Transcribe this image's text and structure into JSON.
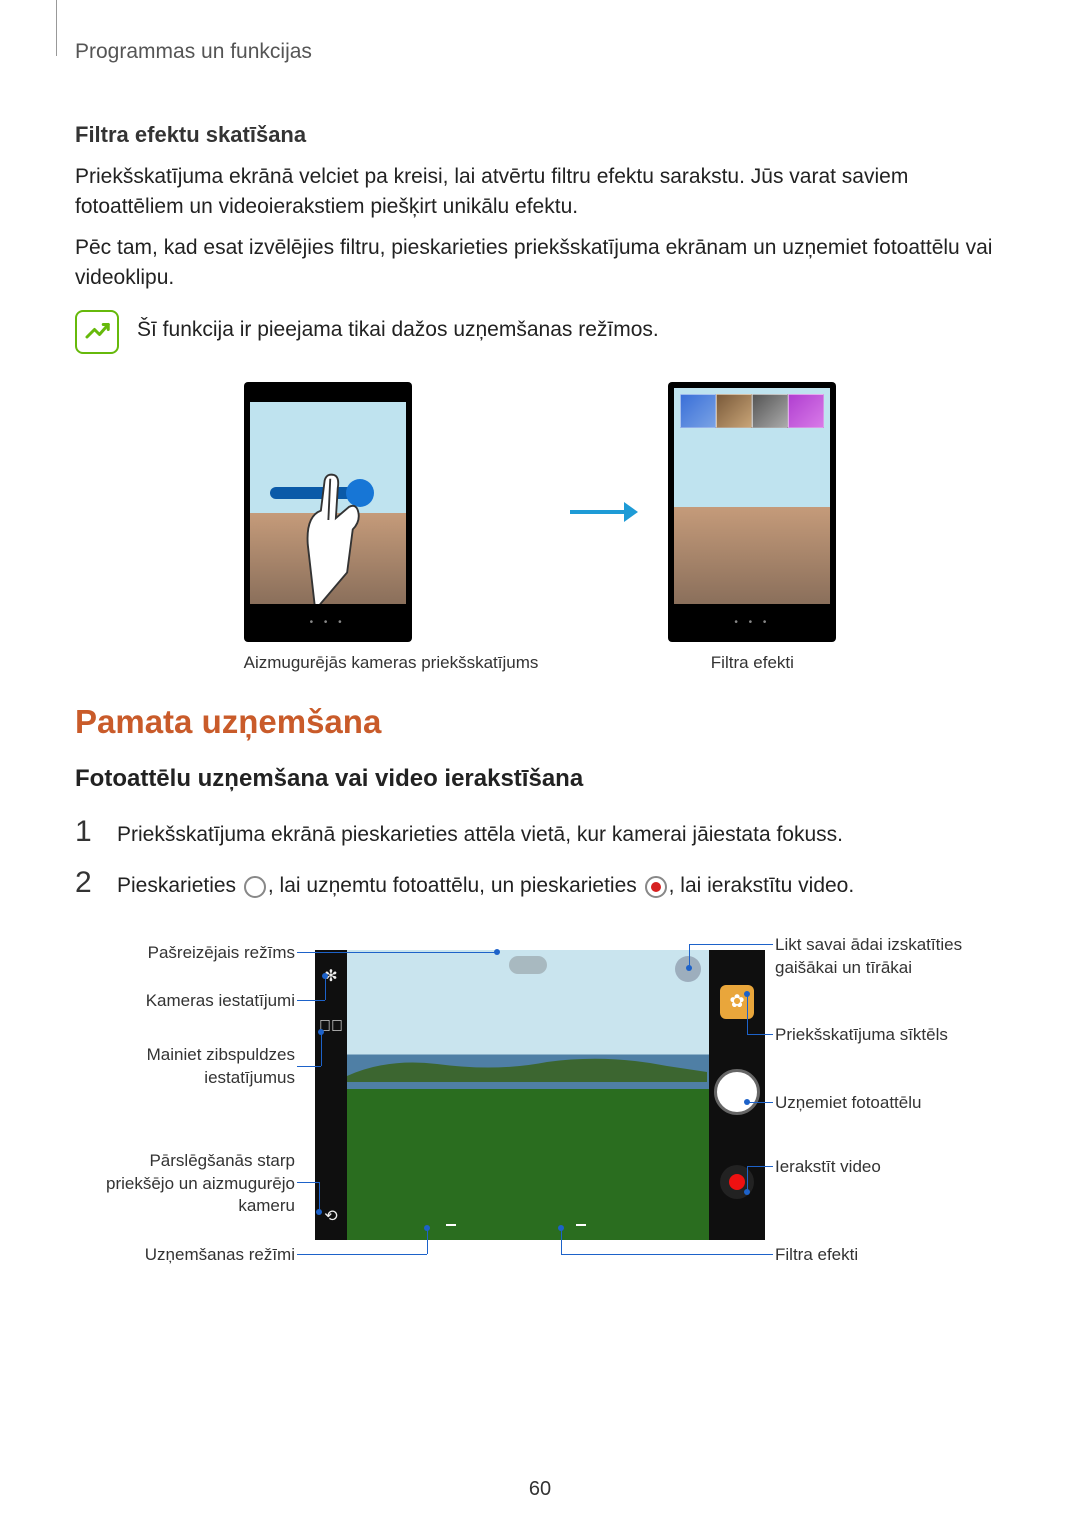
{
  "header": {
    "section": "Programmas un funkcijas"
  },
  "filter": {
    "heading": "Filtra efektu skatīšana",
    "p1": "Priekšskatījuma ekrānā velciet pa kreisi, lai atvērtu filtru efektu sarakstu. Jūs varat saviem fotoattēliem un videoierakstiem piešķirt unikālu efektu.",
    "p2": "Pēc tam, kad esat izvēlējies filtru, pieskarieties priekšskatījuma ekrānam un uzņemiet fotoattēlu vai videoklipu.",
    "note": "Šī funkcija ir pieejama tikai dažos uzņemšanas režīmos.",
    "fig_left": "Aizmugurējās kameras priekšskatījums",
    "fig_right": "Filtra efekti"
  },
  "basic": {
    "h2": "Pamata uzņemšana",
    "h3": "Fotoattēlu uzņemšana vai video ierakstīšana",
    "step1_num": "1",
    "step1": "Priekšskatījuma ekrānā pieskarieties attēla vietā, kur kamerai jāiestata fokuss.",
    "step2_num": "2",
    "step2_a": "Pieskarieties ",
    "step2_b": ", lai uzņemtu fotoattēlu, un pieskarieties ",
    "step2_c": ", lai ierakstītu video."
  },
  "annotations": {
    "left": {
      "mode": "Pašreizējais režīms",
      "settings": "Kameras iestatījumi",
      "flash": "Mainiet zibspuldzes iestatījumus",
      "switch": "Pārslēgšanās starp priekšējo un aizmugurējo kameru",
      "modes": "Uzņemšanas režīmi"
    },
    "right": {
      "beauty": "Likt savai ādai izskatīties gaišākai un tīrākai",
      "thumb": "Priekšskatījuma sīktēls",
      "photo": "Uzņemiet fotoattēlu",
      "video": "Ierakstīt video",
      "filters": "Filtra efekti"
    }
  },
  "page_number": "60"
}
